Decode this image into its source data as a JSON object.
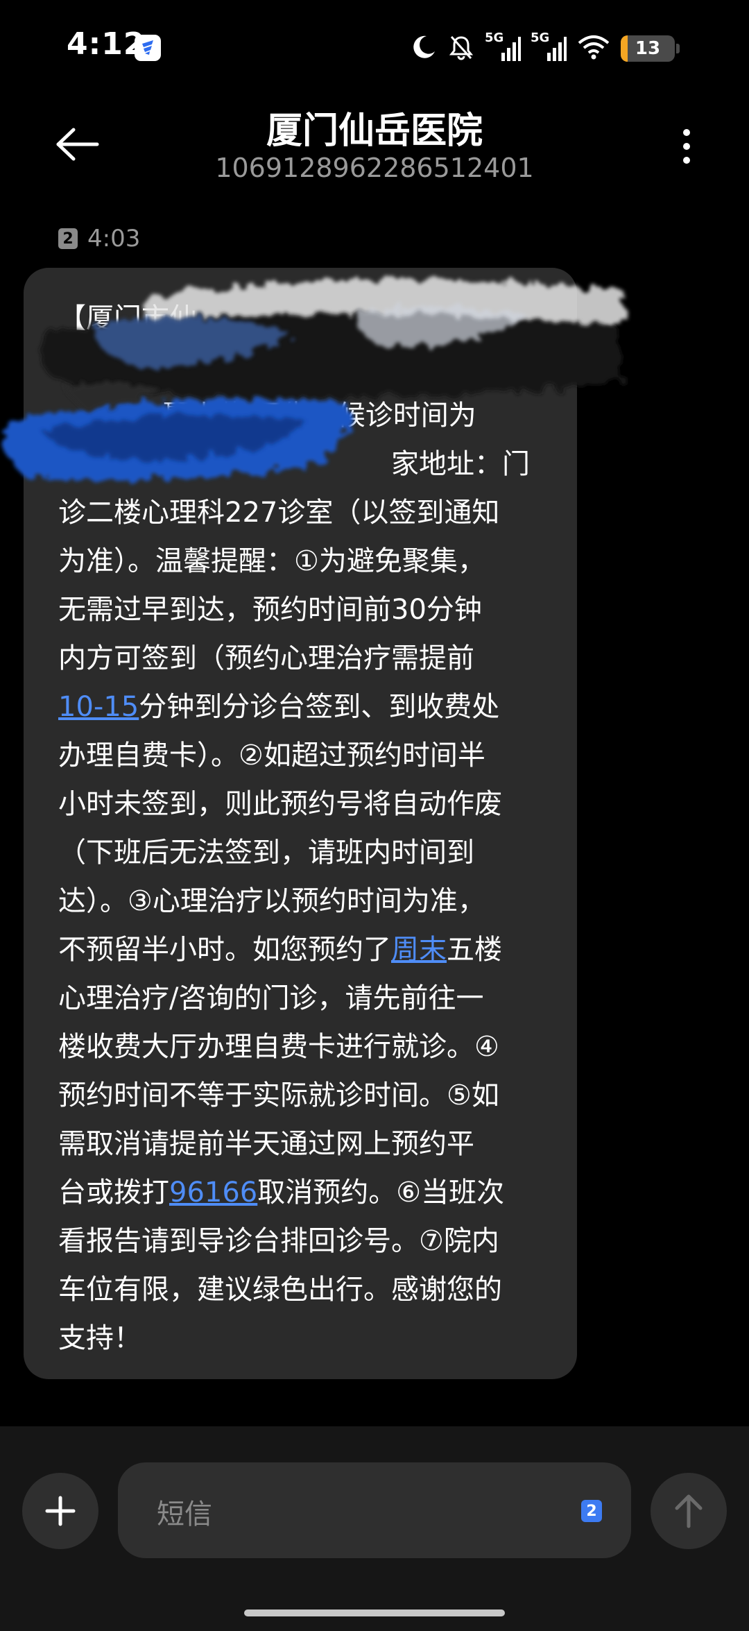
{
  "status_bar": {
    "time": "4:12",
    "network_label_1": "5G",
    "network_label_2": "5G",
    "battery_percent": 13,
    "battery_text": "13"
  },
  "header": {
    "title": "厦门仙岳医院",
    "phone_number": "106912896228651240​1"
  },
  "message": {
    "sim_slot": "2",
    "time": "4:03",
    "lines": [
      "【厦门市仙",
      "",
      "聂小伟 医生，候诊时间为",
      "家地址：门",
      "诊二楼心理科227诊室（以签到通知",
      "为准）。温馨提醒：①为避免聚集，",
      "无需过早到达，预约时间前30分钟",
      "内方可签到（预约心理治疗需提前",
      "分钟到分诊台签到、到收费处",
      "办理自费卡）。②如超过预约时间半",
      "小时未签到，则此预约号将自动作废",
      "（下班后无法签到，请班内时间到",
      "达）。③心理治疗以预约时间为准，",
      "不预留半小时。如您预约了",
      "五楼",
      "心理治疗/咨询的门诊，请先前往一",
      "楼收费大厅办理自费卡进行就诊。④",
      "预约时间不等于实际就诊时间。⑤如",
      "需取消请提前半天通过网上预约平",
      "台或拨打",
      "取消预约。⑥当班次",
      "看报告请到导诊台排回诊号。⑦院内",
      "车位有限，建议绿色出行。感谢您的",
      "支持！"
    ],
    "links": {
      "time_range": "10-15",
      "weekend": "周末",
      "hotline": "96166"
    }
  },
  "composer": {
    "placeholder": "短信",
    "sim_slot": "2"
  },
  "colors": {
    "background": "#000000",
    "bubble": "#2b2b2b",
    "link": "#4f8df7",
    "battery_fill": "#f5a623",
    "sim_badge_active": "#3d7bf2"
  }
}
